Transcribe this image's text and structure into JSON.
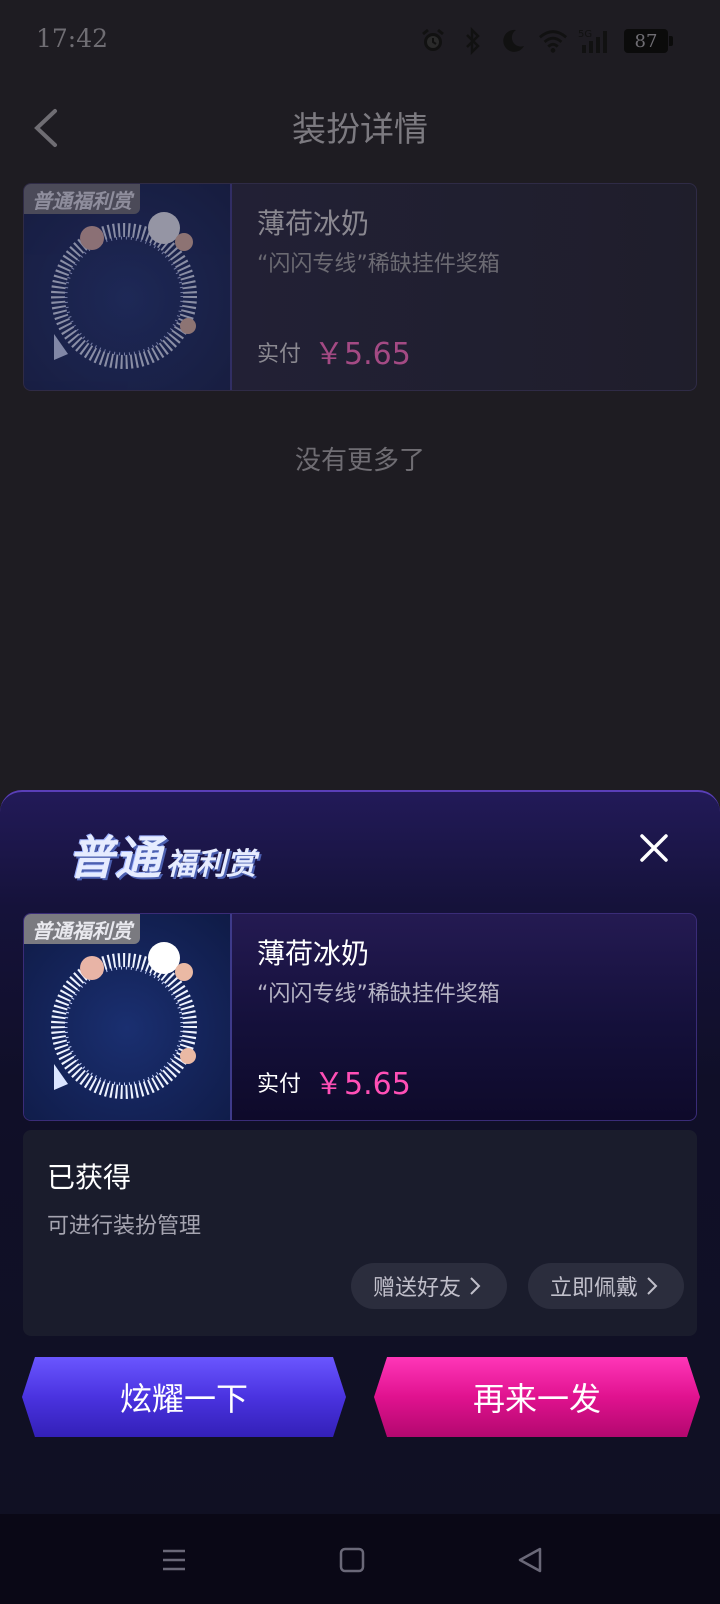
{
  "status_bar": {
    "time": "17:42",
    "battery": "87",
    "network": "5G",
    "icons": [
      "alarm-icon",
      "bluetooth-icon",
      "moon-icon",
      "wifi-icon",
      "signal-icon",
      "battery-icon"
    ]
  },
  "header": {
    "title": "装扮详情",
    "back_icon": "chevron-left-icon"
  },
  "list": {
    "items": [
      {
        "badge": "普通福利赏",
        "name": "薄荷冰奶",
        "desc": "“闪闪专线”稀缺挂件奖箱",
        "paid_label": "实付",
        "price": "￥5.65"
      }
    ],
    "end_text": "没有更多了"
  },
  "sheet": {
    "logo_big": "普通",
    "logo_small": "福利赏",
    "close_icon": "close-icon",
    "item": {
      "badge": "普通福利赏",
      "name": "薄荷冰奶",
      "desc": "“闪闪专线”稀缺挂件奖箱",
      "paid_label": "实付",
      "price": "￥5.65"
    },
    "obtained": {
      "title": "已获得",
      "subtitle": "可进行装扮管理",
      "gift_label": "赠送好友",
      "wear_label": "立即佩戴"
    },
    "show_off_label": "炫耀一下",
    "again_label": "再来一发"
  },
  "colors": {
    "background": "#1e1c22",
    "price_pink": "#ff4fb6",
    "button_purple": "#4a33e0",
    "button_pink": "#e0128f"
  }
}
